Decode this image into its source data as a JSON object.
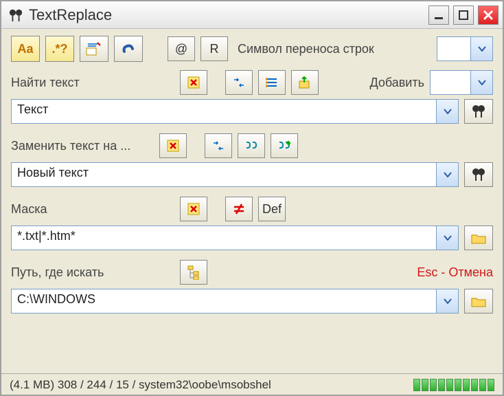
{
  "title": "TextReplace",
  "toolbar1": {
    "aa": "Aa",
    "regex": ".*?",
    "atsign": "@",
    "r": "R",
    "line_sep_label": "Символ переноса строк",
    "line_sep_value": ""
  },
  "section_find": {
    "label": "Найти текст",
    "add_label": "Добавить",
    "add_value": "",
    "value": "Текст"
  },
  "section_replace": {
    "label": "Заменить текст на ...",
    "value": "Новый текст"
  },
  "section_mask": {
    "label": "Маска",
    "def": "Def",
    "value": "*.txt|*.htm*"
  },
  "section_path": {
    "label": "Путь, где искать",
    "esc": "Esc - Отмена",
    "value": "C:\\WINDOWS"
  },
  "status": "(4.1 MB) 308 / 244 / 15 / system32\\oobe\\msobshel"
}
